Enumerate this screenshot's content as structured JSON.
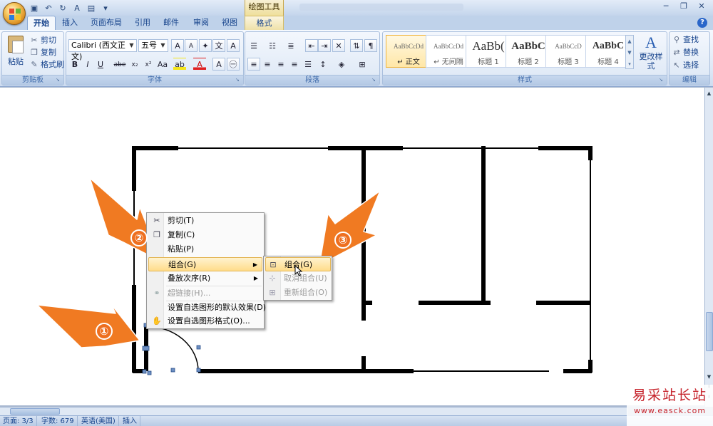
{
  "titlebar": {
    "context_tool": "绘图工具"
  },
  "tabs": [
    {
      "label": "开始"
    },
    {
      "label": "插入"
    },
    {
      "label": "页面布局"
    },
    {
      "label": "引用"
    },
    {
      "label": "邮件"
    },
    {
      "label": "审阅"
    },
    {
      "label": "视图"
    },
    {
      "label": "格式"
    }
  ],
  "ribbon": {
    "clipboard": {
      "paste": "粘贴",
      "cut": "剪切",
      "copy": "复制",
      "format_painter": "格式刷",
      "label": "剪贴板"
    },
    "font": {
      "font_name": "Calibri (西文正文)",
      "font_size": "五号",
      "bold": "B",
      "italic": "I",
      "underline": "U",
      "strike": "abe",
      "subscript": "x₂",
      "superscript": "x²",
      "change_case": "Aa",
      "highlight": "ab",
      "font_color": "A",
      "grow": "A",
      "shrink": "A",
      "clear": "A",
      "label": "字体"
    },
    "paragraph": {
      "label": "段落"
    },
    "styles": {
      "items": [
        {
          "sample": "AaBbCcDd",
          "name": "↵ 正文"
        },
        {
          "sample": "AaBbCcDd",
          "name": "↵ 无间隔"
        },
        {
          "sample": "AaBb(",
          "name": "标题 1"
        },
        {
          "sample": "AaBbC",
          "name": "标题 2"
        },
        {
          "sample": "AaBbCcD",
          "name": "标题 3"
        },
        {
          "sample": "AaBbC",
          "name": "标题 4"
        }
      ],
      "change_styles": "更改样式",
      "label": "样式"
    },
    "editing": {
      "find": "查找",
      "replace": "替换",
      "select": "选择",
      "label": "编辑"
    }
  },
  "context_menu": {
    "items": [
      {
        "label": "剪切(T)",
        "disabled": false
      },
      {
        "label": "复制(C)",
        "disabled": false
      },
      {
        "label": "粘贴(P)",
        "disabled": false
      },
      {
        "label": "组合(G)",
        "disabled": false,
        "submenu": true
      },
      {
        "label": "叠放次序(R)",
        "disabled": false,
        "submenu": true
      },
      {
        "label": "超链接(H)...",
        "disabled": true
      },
      {
        "label": "设置自选图形的默认效果(D)",
        "disabled": false
      },
      {
        "label": "设置自选图形格式(O)...",
        "disabled": false
      }
    ]
  },
  "submenu": {
    "items": [
      {
        "label": "组合(G)",
        "disabled": false
      },
      {
        "label": "取消组合(U)",
        "disabled": true
      },
      {
        "label": "重新组合(O)",
        "disabled": true
      }
    ]
  },
  "annotations": {
    "step1": "①",
    "step2": "②",
    "step3": "③",
    "color": "#ee6f1f"
  },
  "statusbar": {
    "page": "页面: 3/3",
    "words": "字数: 679",
    "language": "英语(美国)",
    "mode": "插入"
  },
  "watermark": {
    "cn": "易采站长站",
    "url": "www.easck.com"
  }
}
